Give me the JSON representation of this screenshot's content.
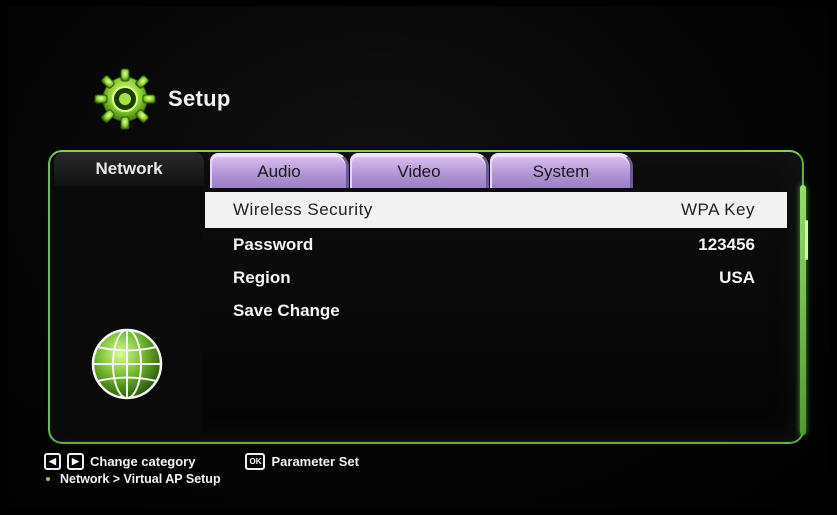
{
  "header": {
    "title": "Setup",
    "icon": "gear-icon"
  },
  "tabs": {
    "active": "Network",
    "items": [
      "Audio",
      "Video",
      "System"
    ]
  },
  "settings": [
    {
      "label": "Wireless Security",
      "value": "WPA Key",
      "selected": true
    },
    {
      "label": "Password",
      "value": "123456",
      "selected": false
    },
    {
      "label": "Region",
      "value": "USA",
      "selected": false
    },
    {
      "label": "Save Change",
      "value": "",
      "selected": false
    }
  ],
  "footer": {
    "left_key": "◀",
    "right_key": "▶",
    "change_category": "Change category",
    "ok_key": "OK",
    "parameter_set": "Parameter Set",
    "breadcrumb": "Network > Virtual AP Setup"
  },
  "colors": {
    "accent_green": "#7fd25a",
    "tab_purple": "#b396d8",
    "selection_bg": "#f2f2f2"
  }
}
